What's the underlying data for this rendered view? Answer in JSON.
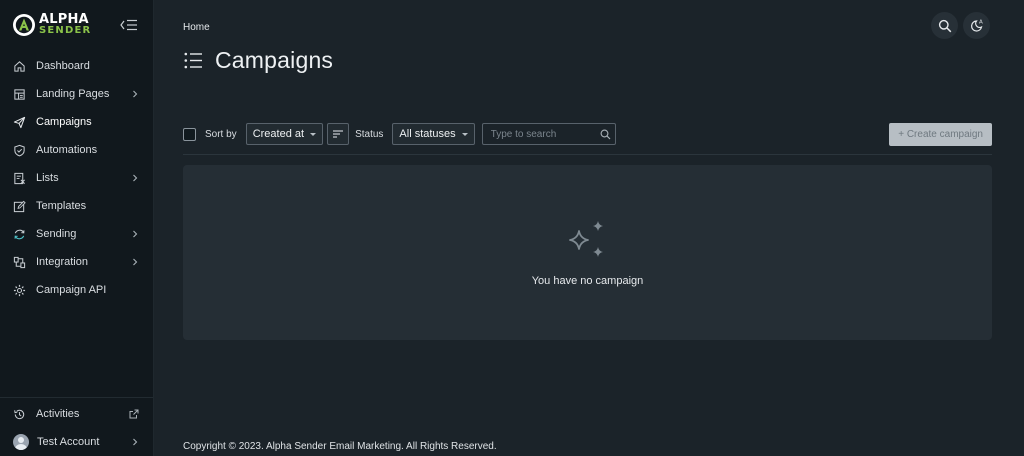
{
  "brand": {
    "line1": "ALPHA",
    "line2": "SENDER",
    "accent": "#8bc34a"
  },
  "sidebar": {
    "items": [
      {
        "label": "Dashboard",
        "icon": "home-icon",
        "has_children": false
      },
      {
        "label": "Landing Pages",
        "icon": "layout-icon",
        "has_children": true
      },
      {
        "label": "Campaigns",
        "icon": "send-icon",
        "has_children": false,
        "active": true
      },
      {
        "label": "Automations",
        "icon": "shield-check-icon",
        "has_children": false
      },
      {
        "label": "Lists",
        "icon": "list-box-icon",
        "has_children": true
      },
      {
        "label": "Templates",
        "icon": "edit-icon",
        "has_children": false
      },
      {
        "label": "Sending",
        "icon": "sync-icon",
        "has_children": true
      },
      {
        "label": "Integration",
        "icon": "plug-icon",
        "has_children": true
      },
      {
        "label": "Campaign API",
        "icon": "gear-icon",
        "has_children": false
      }
    ],
    "bottom": {
      "activities": "Activities",
      "account": "Test Account"
    }
  },
  "header": {
    "breadcrumb": "Home",
    "title": "Campaigns"
  },
  "toolbar": {
    "sort_by_label": "Sort by",
    "sort_selected": "Created at",
    "status_label": "Status",
    "status_selected": "All statuses",
    "search_placeholder": "Type to search",
    "create_label": "+ Create campaign"
  },
  "empty_state": {
    "message": "You have no campaign"
  },
  "footer": {
    "copyright": "Copyright © 2023. Alpha Sender Email Marketing. All Rights Reserved."
  }
}
